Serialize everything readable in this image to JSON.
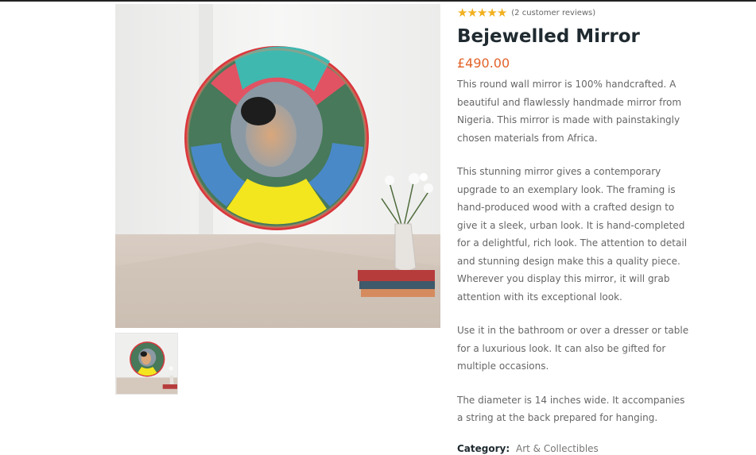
{
  "rating": {
    "stars": 5,
    "color": "#f2b01e",
    "reviews_link": "(2 customer reviews)"
  },
  "product": {
    "title": "Bejewelled Mirror",
    "price": "£490.00",
    "price_color": "#e2632a",
    "description": [
      "This round wall mirror is 100% handcrafted. A beautiful and flawlessly handmade mirror from Nigeria. This mirror is made with painstakingly chosen materials from Africa.",
      "This stunning mirror gives a contemporary upgrade to an exemplary look. The framing is hand-produced wood with a crafted design to give it a sleek, urban look. It is hand-completed for a delightful, rich look. The attention to detail and stunning design make this a quality piece. Wherever you display this mirror, it will grab attention with its exceptional look.",
      "Use it in the bathroom or over a dresser or table for a luxurious look. It can also be gifted for multiple occasions.",
      "The diameter is 14 inches wide. It accompanies a string at the back prepared for hanging."
    ],
    "category_label": "Category:",
    "category_value": "Art & Collectibles"
  }
}
